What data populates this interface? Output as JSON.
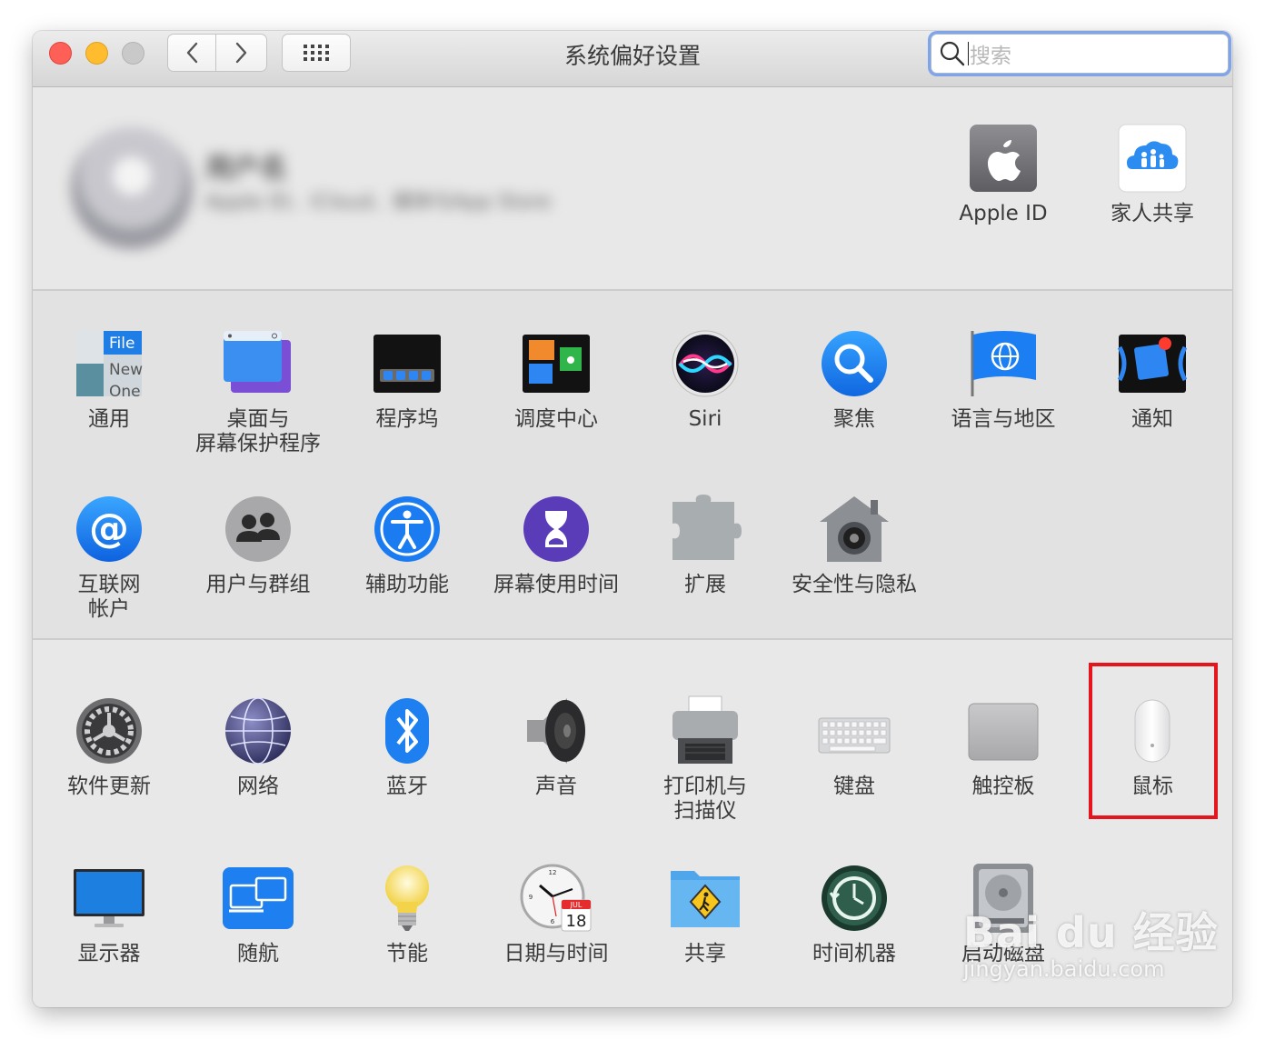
{
  "window": {
    "title": "系统偏好设置"
  },
  "toolbar": {
    "search_placeholder": "搜索"
  },
  "account": {
    "blurred_name": "用户名",
    "blurred_email": "Apple ID、iCloud、媒体与App Store",
    "apple_id_label": "Apple ID",
    "family_label": "家人共享"
  },
  "row1": [
    {
      "label": "通用",
      "icon": "general-icon"
    },
    {
      "label": "桌面与\n屏幕保护程序",
      "icon": "desktop-icon"
    },
    {
      "label": "程序坞",
      "icon": "dock-icon"
    },
    {
      "label": "调度中心",
      "icon": "mission-control-icon"
    },
    {
      "label": "Siri",
      "icon": "siri-icon"
    },
    {
      "label": "聚焦",
      "icon": "spotlight-icon"
    },
    {
      "label": "语言与地区",
      "icon": "language-region-icon"
    },
    {
      "label": "通知",
      "icon": "notifications-icon"
    }
  ],
  "row2": [
    {
      "label": "互联网\n帐户",
      "icon": "internet-accounts-icon"
    },
    {
      "label": "用户与群组",
      "icon": "users-groups-icon"
    },
    {
      "label": "辅助功能",
      "icon": "accessibility-icon"
    },
    {
      "label": "屏幕使用时间",
      "icon": "screen-time-icon"
    },
    {
      "label": "扩展",
      "icon": "extensions-icon"
    },
    {
      "label": "安全性与隐私",
      "icon": "security-privacy-icon"
    }
  ],
  "row3": [
    {
      "label": "软件更新",
      "icon": "software-update-icon"
    },
    {
      "label": "网络",
      "icon": "network-icon"
    },
    {
      "label": "蓝牙",
      "icon": "bluetooth-icon"
    },
    {
      "label": "声音",
      "icon": "sound-icon"
    },
    {
      "label": "打印机与\n扫描仪",
      "icon": "printer-icon"
    },
    {
      "label": "键盘",
      "icon": "keyboard-icon"
    },
    {
      "label": "触控板",
      "icon": "trackpad-icon"
    },
    {
      "label": "鼠标",
      "icon": "mouse-icon"
    }
  ],
  "row4": [
    {
      "label": "显示器",
      "icon": "displays-icon"
    },
    {
      "label": "随航",
      "icon": "sidecar-icon"
    },
    {
      "label": "节能",
      "icon": "energy-saver-icon"
    },
    {
      "label": "日期与时间",
      "icon": "date-time-icon"
    },
    {
      "label": "共享",
      "icon": "sharing-icon"
    },
    {
      "label": "时间机器",
      "icon": "time-machine-icon"
    },
    {
      "label": "启动磁盘",
      "icon": "startup-disk-icon"
    }
  ],
  "icon_text": {
    "general": [
      "File",
      "New",
      "One"
    ],
    "calendar_month": "JUL",
    "calendar_day": "18"
  },
  "watermark": {
    "main": "Bai du 经验",
    "url": "jingyan.baidu.com"
  },
  "colors": {
    "accent": "#1a82f7",
    "highlight_box": "#e4151c"
  }
}
